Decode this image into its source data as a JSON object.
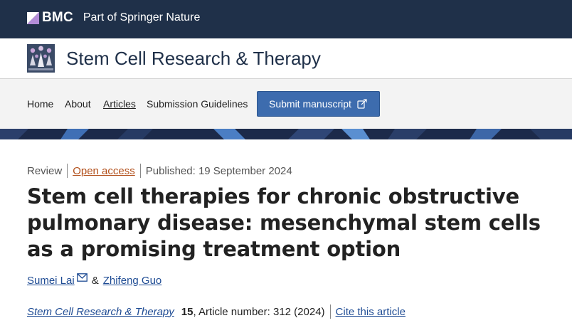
{
  "publisher": {
    "brand": "BMC",
    "tagline": "Part of Springer Nature",
    "bar_color": "#1f3049"
  },
  "journal": {
    "title": "Stem Cell Research & Therapy"
  },
  "nav": {
    "home": "Home",
    "about": "About",
    "articles": "Articles",
    "guidelines": "Submission Guidelines",
    "submit": "Submit manuscript",
    "submit_color": "#3d6cae"
  },
  "article": {
    "type": "Review",
    "access": "Open access",
    "published": "Published: 19 September 2024",
    "title": "Stem cell therapies for chronic obstructive pulmonary disease: mesenchymal stem cells as a promising treatment option",
    "authors": {
      "author1": "Sumei Lai",
      "and": "&",
      "author2": "Zhifeng Guo"
    },
    "citation": {
      "journal": "Stem Cell Research & Therapy",
      "volume": "15",
      "rest": ", Article number: 312 (2024)",
      "cite_link": "Cite this article"
    }
  },
  "colors": {
    "link": "#1f4c94",
    "open_access": "#b24f1a"
  }
}
